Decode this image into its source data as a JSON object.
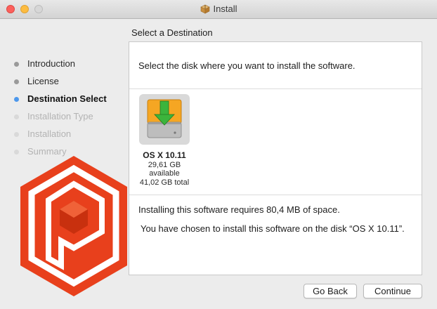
{
  "window": {
    "title": "Install"
  },
  "header": {
    "step_title": "Select a Destination"
  },
  "sidebar": {
    "items": [
      {
        "label": "Introduction",
        "state": "done"
      },
      {
        "label": "License",
        "state": "done"
      },
      {
        "label": "Destination Select",
        "state": "current"
      },
      {
        "label": "Installation Type",
        "state": "future"
      },
      {
        "label": "Installation",
        "state": "future"
      },
      {
        "label": "Summary",
        "state": "future"
      }
    ]
  },
  "main": {
    "prompt": "Select the disk where you want to install the  software.",
    "disk": {
      "name": "OS X 10.11",
      "available": "29,61 GB available",
      "total": "41,02 GB total"
    },
    "space_note": "Installing this software requires 80,4 MB of space.",
    "chosen_note": "You have chosen to install this software on the disk “OS X 10.11”."
  },
  "buttons": {
    "back": "Go Back",
    "continue": "Continue"
  },
  "colors": {
    "accent": "#4d98ec",
    "close": "#fc605c",
    "minimize": "#fdbc40",
    "logo_red": "#e8401c",
    "drive_orange": "#f5a623",
    "arrow_green": "#3cb43c"
  },
  "icons": {
    "title": "package-icon",
    "disk": "hard-drive-install-icon",
    "logo": "hexagon-p-logo"
  }
}
